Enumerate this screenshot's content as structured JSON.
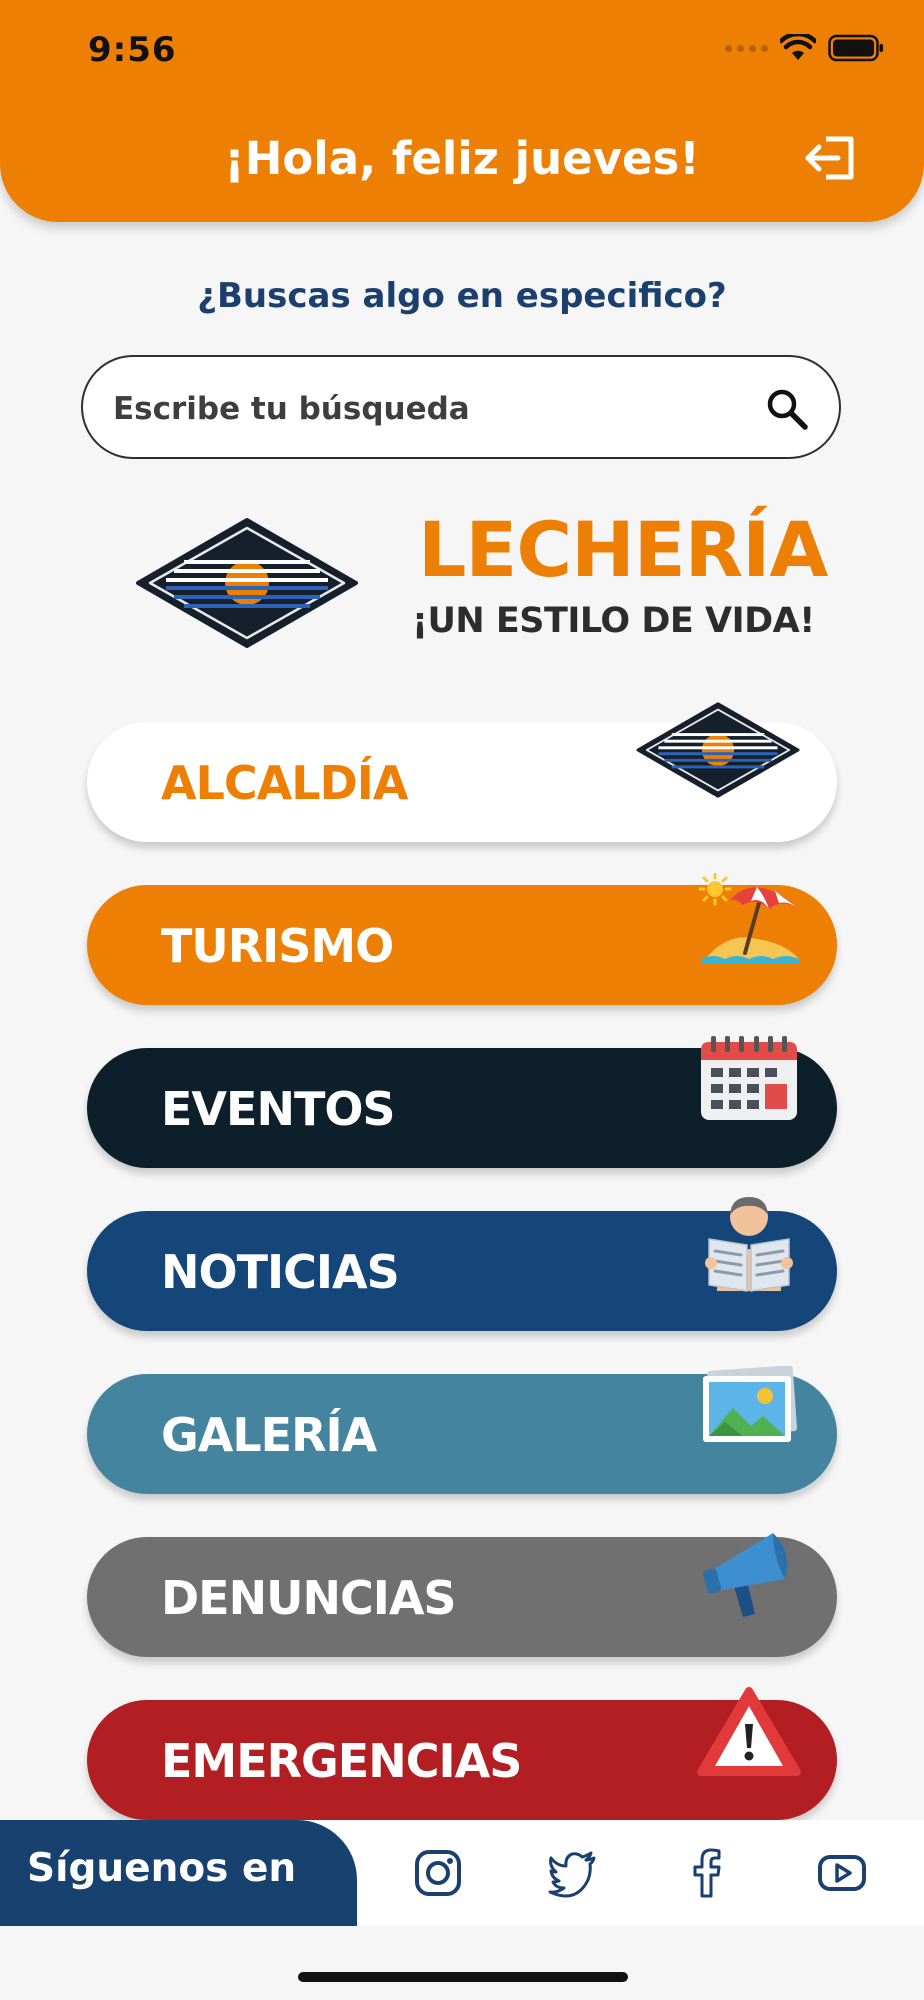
{
  "status_bar": {
    "time": "9:56"
  },
  "header": {
    "greeting": "¡Hola, feliz jueves!",
    "logout_icon": "logout-icon"
  },
  "search": {
    "question": "¿Buscas algo en especifico?",
    "placeholder": "Escribe tu búsqueda",
    "value": ""
  },
  "brand": {
    "name": "LECHERÍA",
    "slogan": "¡UN ESTILO DE VIDA!"
  },
  "menu": [
    {
      "label": "ALCALDÍA",
      "bg": "#ffffff",
      "text_color": "#ed7f05",
      "icon": "city-logo-icon"
    },
    {
      "label": "TURISMO",
      "bg": "#ed7f05",
      "text_color": "#ffffff",
      "icon": "beach-umbrella-icon"
    },
    {
      "label": "EVENTOS",
      "bg": "#0e1f2c",
      "text_color": "#ffffff",
      "icon": "calendar-icon"
    },
    {
      "label": "NOTICIAS",
      "bg": "#15467a",
      "text_color": "#ffffff",
      "icon": "newspaper-reader-icon"
    },
    {
      "label": "GALERÍA",
      "bg": "#44849f",
      "text_color": "#ffffff",
      "icon": "picture-icon"
    },
    {
      "label": "DENUNCIAS",
      "bg": "#707070",
      "text_color": "#ffffff",
      "icon": "megaphone-icon"
    },
    {
      "label": "EMERGENCIAS",
      "bg": "#b21e22",
      "text_color": "#ffffff",
      "icon": "warning-icon"
    }
  ],
  "footer": {
    "follow_label": "Síguenos en",
    "socials": [
      "instagram-icon",
      "twitter-icon",
      "facebook-icon",
      "youtube-icon"
    ]
  },
  "colors": {
    "accent": "#ed7f05",
    "navy": "#17426f",
    "background": "#f6f6f6"
  }
}
